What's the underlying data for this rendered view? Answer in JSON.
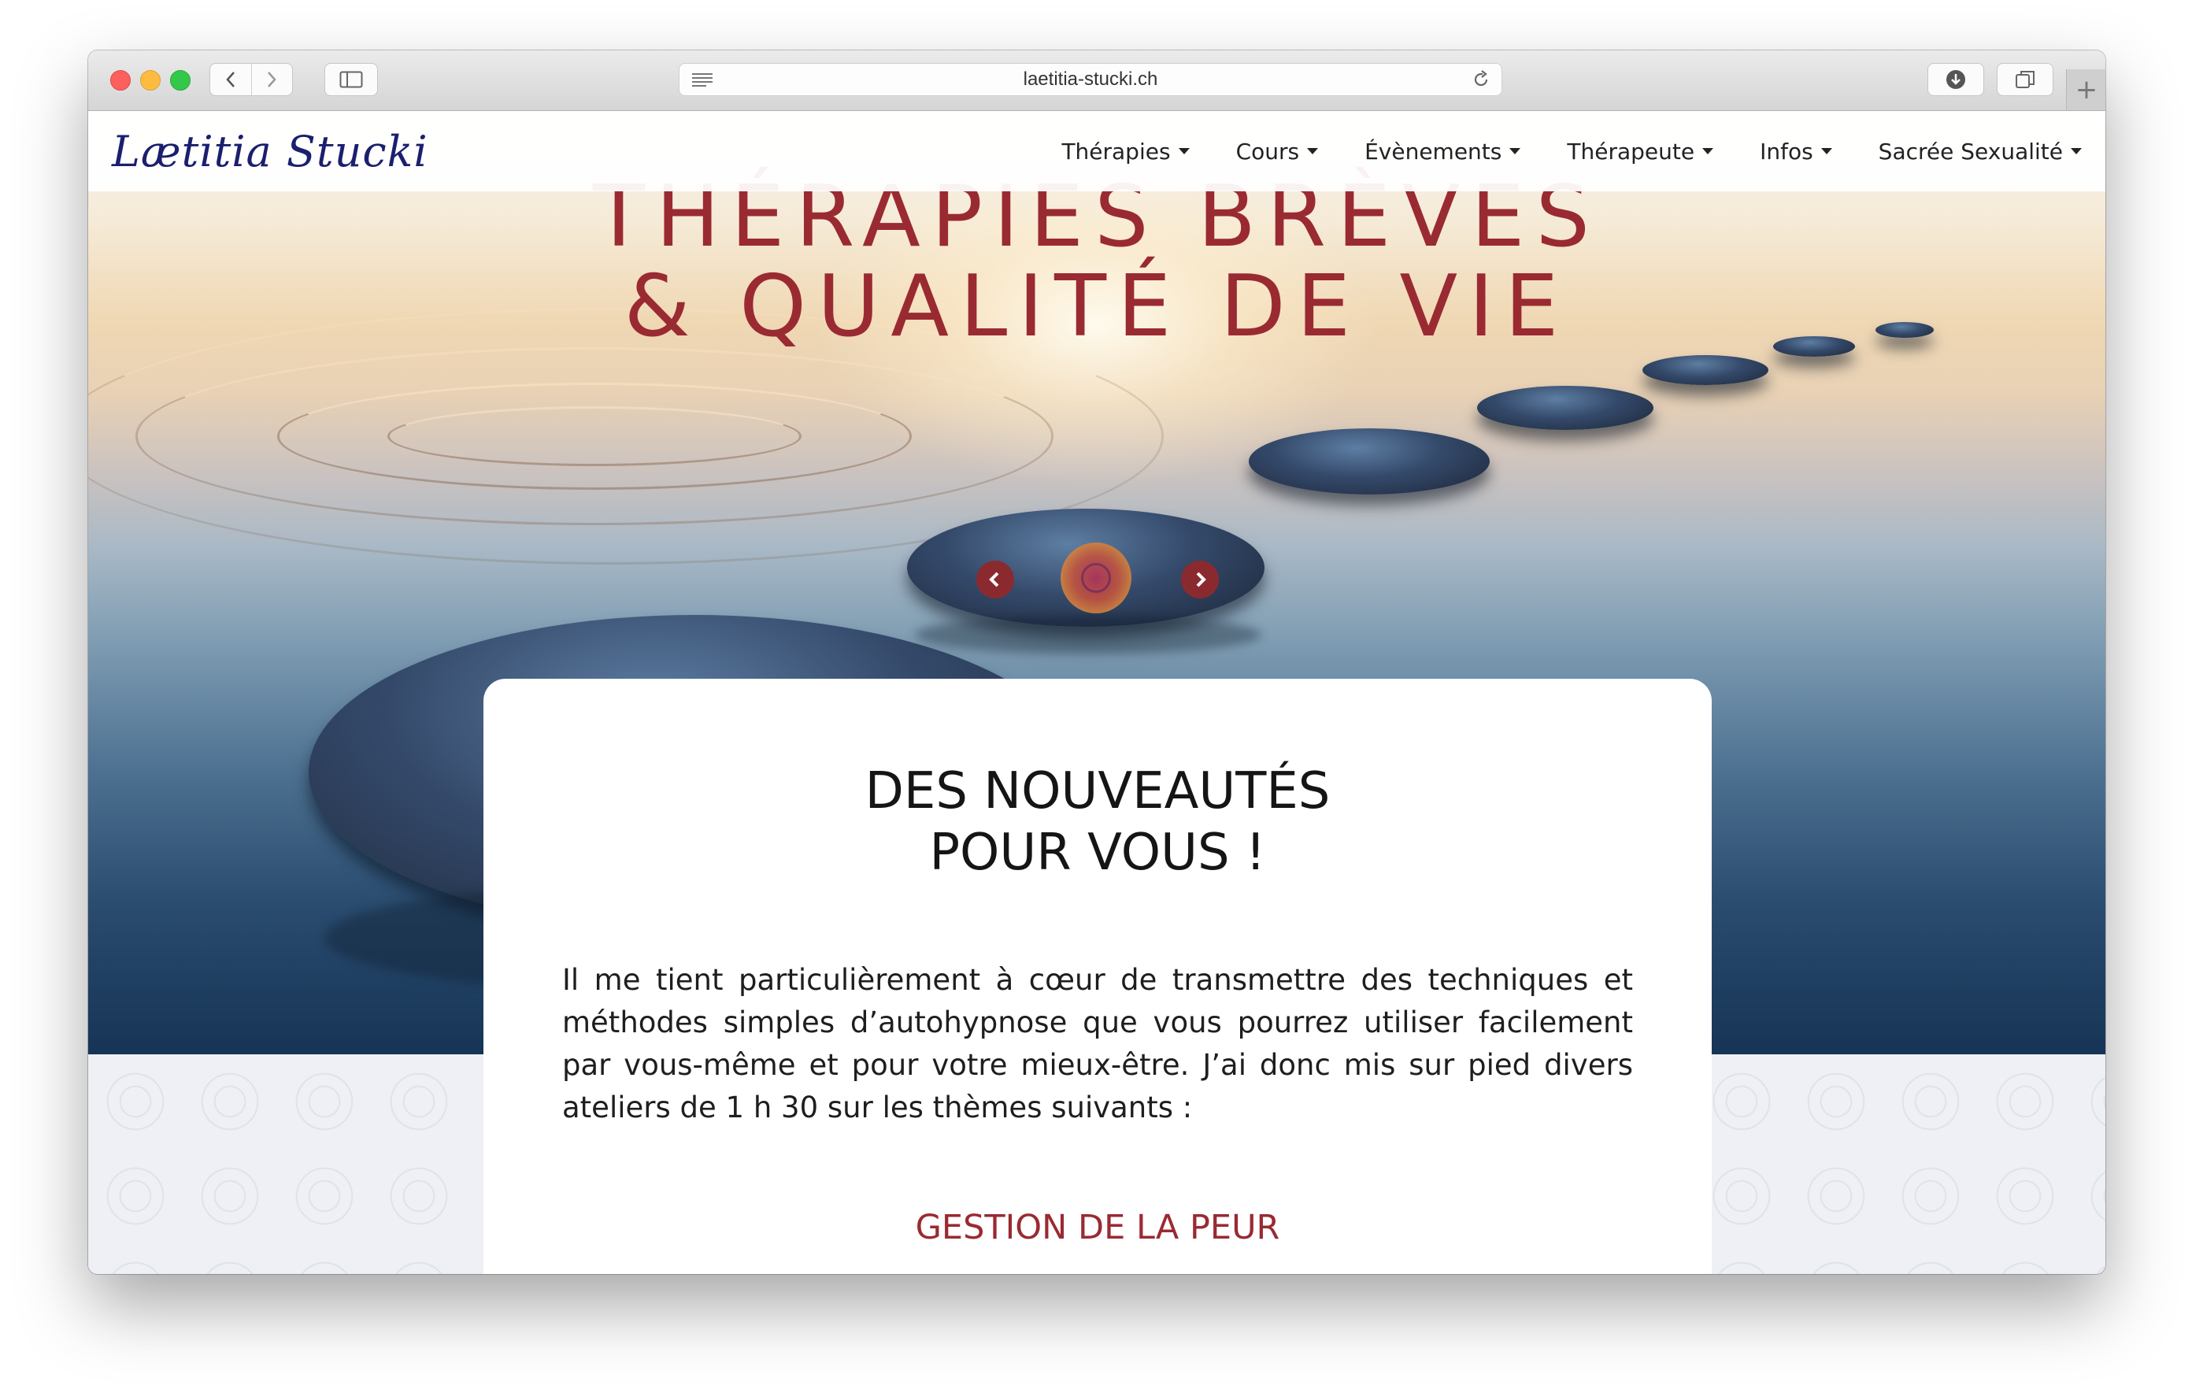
{
  "browser": {
    "url": "laetitia-stucki.ch"
  },
  "site": {
    "logo": "Lætitia Stucki",
    "nav": [
      {
        "label": "Thérapies"
      },
      {
        "label": "Cours"
      },
      {
        "label": "Évènements"
      },
      {
        "label": "Thérapeute"
      },
      {
        "label": "Infos"
      },
      {
        "label": "Sacrée Sexualité"
      }
    ]
  },
  "hero": {
    "title_line1": "THÉRAPIES BRÈVES",
    "title_line2": "& QUALITÉ DE VIE"
  },
  "card": {
    "title_line1": "DES NOUVEAUTÉS",
    "title_line2": "POUR VOUS !",
    "body": "Il me tient particulièrement à cœur de transmettre des techniques et méthodes simples d’autohypnose que vous pourrez utiliser facilement par vous-même et pour votre mieux-être. J’ai donc mis sur pied divers ateliers de 1 h 30 sur les thèmes suivants :",
    "subtitle": "GESTION DE LA PEUR"
  },
  "colors": {
    "accent": "#9a2a32",
    "logo": "#1a1f6e"
  },
  "icons": [
    "back-icon",
    "forward-icon",
    "sidebar-icon",
    "reader-icon",
    "reload-icon",
    "download-icon",
    "tabs-icon",
    "plus-icon",
    "caret-down-icon",
    "slider-prev-icon",
    "slider-next-icon",
    "leaf-icon"
  ]
}
